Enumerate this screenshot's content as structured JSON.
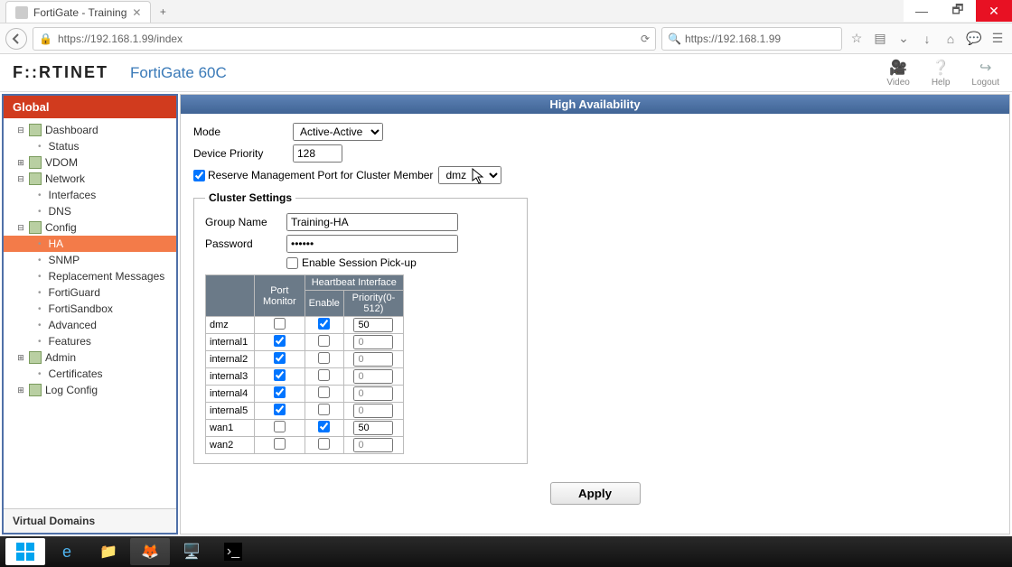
{
  "browser": {
    "tab_title": "FortiGate - Training",
    "url": "https://192.168.1.99/index",
    "search": "https://192.168.1.99"
  },
  "header": {
    "brand": "F::RTINET",
    "model": "FortiGate 60C",
    "actions": {
      "video": "Video",
      "help": "Help",
      "logout": "Logout"
    }
  },
  "sidebar": {
    "title": "Global",
    "items": [
      {
        "type": "node",
        "exp": "-",
        "label": "Dashboard"
      },
      {
        "type": "leaf",
        "label": "Status"
      },
      {
        "type": "node",
        "exp": "+",
        "label": "VDOM"
      },
      {
        "type": "node",
        "exp": "-",
        "label": "Network"
      },
      {
        "type": "leaf",
        "label": "Interfaces"
      },
      {
        "type": "leaf",
        "label": "DNS"
      },
      {
        "type": "node",
        "exp": "-",
        "label": "Config"
      },
      {
        "type": "leaf",
        "label": "HA",
        "selected": true
      },
      {
        "type": "leaf",
        "label": "SNMP"
      },
      {
        "type": "leaf",
        "label": "Replacement Messages"
      },
      {
        "type": "leaf",
        "label": "FortiGuard"
      },
      {
        "type": "leaf",
        "label": "FortiSandbox"
      },
      {
        "type": "leaf",
        "label": "Advanced"
      },
      {
        "type": "leaf",
        "label": "Features"
      },
      {
        "type": "node",
        "exp": "+",
        "label": "Admin"
      },
      {
        "type": "leaf",
        "label": "Certificates"
      },
      {
        "type": "node",
        "exp": "+",
        "label": "Log Config"
      }
    ],
    "footer": "Virtual Domains"
  },
  "content": {
    "title": "High Availability",
    "mode_label": "Mode",
    "mode_value": "Active-Active",
    "priority_label": "Device Priority",
    "priority_value": "128",
    "reserve_checked": true,
    "reserve_label": "Reserve Management Port for Cluster Member",
    "reserve_port": "dmz",
    "cluster": {
      "legend": "Cluster Settings",
      "group_label": "Group Name",
      "group_value": "Training-HA",
      "password_label": "Password",
      "password_value": "••••••",
      "session_pickup_checked": false,
      "session_pickup_label": "Enable Session Pick-up"
    },
    "table": {
      "hdr_port_monitor": "Port Monitor",
      "hdr_heartbeat": "Heartbeat Interface",
      "hdr_enable": "Enable",
      "hdr_priority": "Priority(0-512)",
      "rows": [
        {
          "iface": "dmz",
          "pm": false,
          "en": true,
          "pri": "50",
          "pri_disabled": false
        },
        {
          "iface": "internal1",
          "pm": true,
          "en": false,
          "pri": "0",
          "pri_disabled": true
        },
        {
          "iface": "internal2",
          "pm": true,
          "en": false,
          "pri": "0",
          "pri_disabled": true
        },
        {
          "iface": "internal3",
          "pm": true,
          "en": false,
          "pri": "0",
          "pri_disabled": true
        },
        {
          "iface": "internal4",
          "pm": true,
          "en": false,
          "pri": "0",
          "pri_disabled": true
        },
        {
          "iface": "internal5",
          "pm": true,
          "en": false,
          "pri": "0",
          "pri_disabled": true
        },
        {
          "iface": "wan1",
          "pm": false,
          "en": true,
          "pri": "50",
          "pri_disabled": false
        },
        {
          "iface": "wan2",
          "pm": false,
          "en": false,
          "pri": "0",
          "pri_disabled": true
        }
      ]
    },
    "apply_label": "Apply"
  },
  "taskbar": {
    "items": [
      "start",
      "ie",
      "files",
      "firefox",
      "scan",
      "cmd"
    ]
  }
}
